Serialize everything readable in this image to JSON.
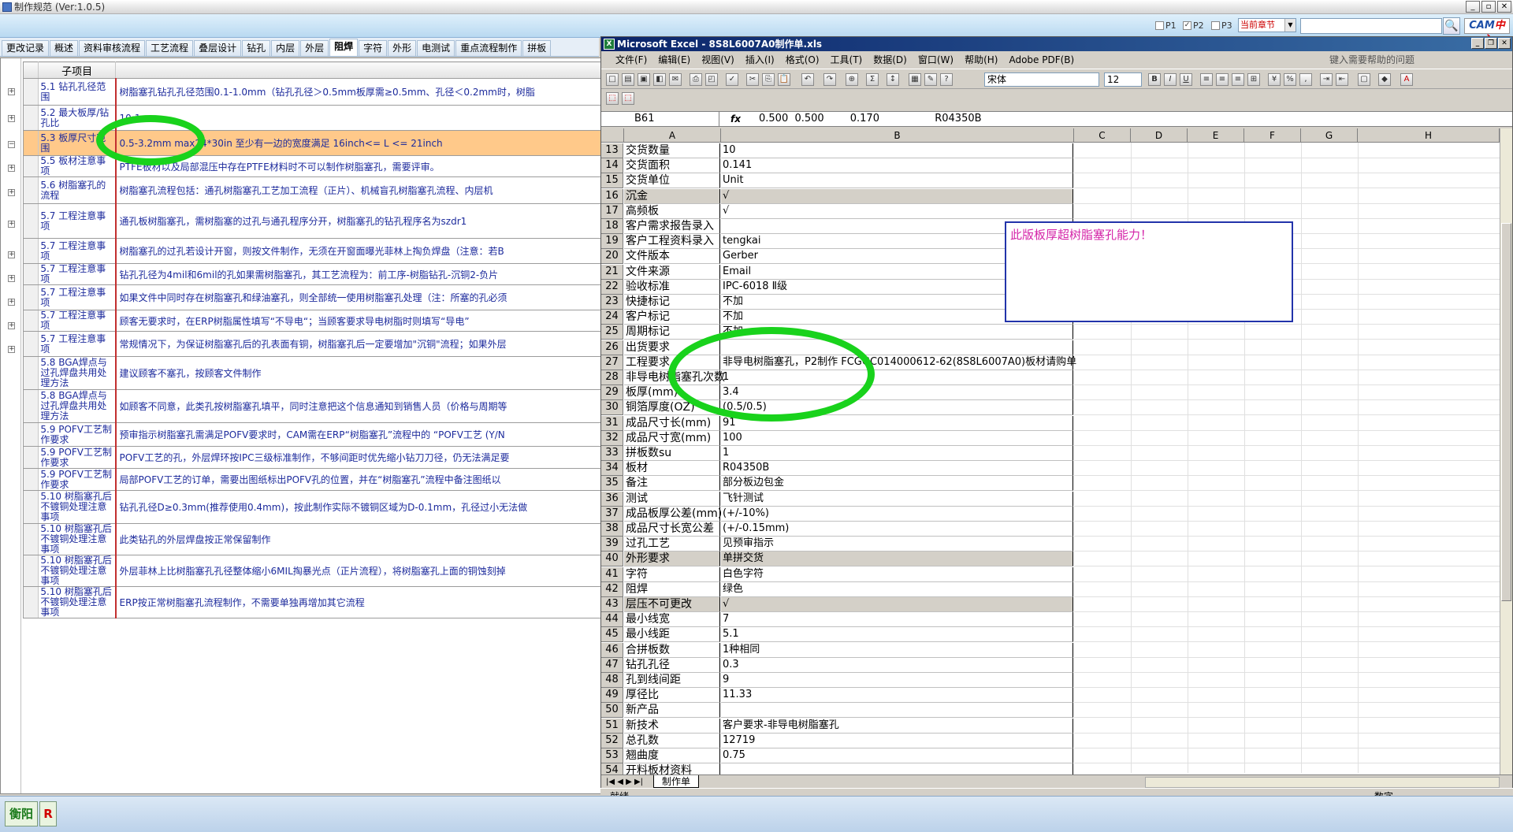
{
  "app": {
    "title": "制作规范 (Ver:1.0.5)",
    "filters": [
      {
        "label": "P1",
        "checked": false
      },
      {
        "label": "P2",
        "checked": true
      },
      {
        "label": "P3",
        "checked": false
      }
    ],
    "scope_select": "当前章节",
    "search_value": "",
    "logo": {
      "main": "CAM",
      "accent": "中心"
    }
  },
  "tabs": [
    "更改记录",
    "概述",
    "资料审核流程",
    "工艺流程",
    "叠层设计",
    "钻孔",
    "内层",
    "外层",
    "阻焊",
    "字符",
    "外形",
    "电测试",
    "重点流程制作",
    "拼板"
  ],
  "active_tab": "阻焊",
  "spec_table": {
    "header": "子项目",
    "rows": [
      {
        "item": "5.1 钻孔孔径范围",
        "text": "树脂塞孔钻孔孔径范围0.1-1.0mm（钻孔孔径＞0.5mm板厚需≥0.5mm、孔径＜0.2mm时，树脂"
      },
      {
        "item": "5.2 最大板厚/钻孔比",
        "text": "10:1"
      },
      {
        "item": "5.3 板厚尺寸范围",
        "text": "0.5-3.2mm    max24*30in 至少有一边的宽度满足 16inch<= L <= 21inch",
        "highlight": true
      },
      {
        "item": "5.5 板材注意事项",
        "text": "PTFE板材以及局部混压中存在PTFE材料时不可以制作树脂塞孔，需要评审。"
      },
      {
        "item": "5.6 树脂塞孔的流程",
        "text": "树脂塞孔流程包括：通孔树脂塞孔工艺加工流程（正片）、机械盲孔树脂塞孔流程、内层机"
      },
      {
        "item": "5.7 工程注意事项",
        "text": "通孔板树脂塞孔，需树脂塞的过孔与通孔程序分开，树脂塞孔的钻孔程序名为szdr1"
      },
      {
        "item": "5.7 工程注意事项",
        "text": "树脂塞孔的过孔若设计开窗，则按文件制作，无须在开窗面曝光菲林上掏负焊盘（注意：若B"
      },
      {
        "item": "5.7 工程注意事项",
        "text": "钻孔孔径为4mil和6mil的孔如果需树脂塞孔，其工艺流程为：前工序-树脂钻孔-沉铜2-负片"
      },
      {
        "item": "5.7 工程注意事项",
        "text": "如果文件中同时存在树脂塞孔和绿油塞孔，则全部统一使用树脂塞孔处理（注：所塞的孔必须"
      },
      {
        "item": "5.7 工程注意事项",
        "text": "顾客无要求时，在ERP树脂属性填写“不导电“；当顾客要求导电树脂时则填写“导电”"
      },
      {
        "item": "5.7 工程注意事项",
        "text": "常规情况下，为保证树脂塞孔后的孔表面有铜，树脂塞孔后一定要增加\"沉铜\"流程；如果外层"
      },
      {
        "item": "5.8 BGA焊点与过孔焊盘共用处理方法",
        "text": "建议顾客不塞孔，按顾客文件制作"
      },
      {
        "item": "5.8 BGA焊点与过孔焊盘共用处理方法",
        "text": "如顾客不同意，此类孔按树脂塞孔填平，同时注意把这个信息通知到销售人员（价格与周期等"
      },
      {
        "item": "5.9 POFV工艺制作要求",
        "text": "预审指示树脂塞孔需满足POFV要求时，CAM需在ERP“树脂塞孔”流程中的 “POFV工艺 (Y/N"
      },
      {
        "item": "5.9 POFV工艺制作要求",
        "text": "POFV工艺的孔，外层焊环按IPC三级标准制作，不够间距时优先缩小钻刀刀径，仍无法满足要"
      },
      {
        "item": "5.9 POFV工艺制作要求",
        "text": "局部POFV工艺的订单，需要出图纸标出POFV孔的位置，并在“树脂塞孔”流程中备注图纸以"
      },
      {
        "item": "5.10 树脂塞孔后不镀铜处理注意事项",
        "text": "钻孔孔径D≥0.3mm(推荐使用0.4mm)，按此制作实际不镀铜区域为D-0.1mm，孔径过小无法做"
      },
      {
        "item": "5.10 树脂塞孔后不镀铜处理注意事项",
        "text": "此类钻孔的外层焊盘按正常保留制作"
      },
      {
        "item": "5.10 树脂塞孔后不镀铜处理注意事项",
        "text": "外层菲林上比树脂塞孔孔径整体缩小6MIL掏暴光点（正片流程），将树脂塞孔上面的铜蚀刻掉"
      },
      {
        "item": "5.10 树脂塞孔后不镀铜处理注意事项",
        "text": "ERP按正常树脂塞孔流程制作，不需要单独再增加其它流程"
      }
    ]
  },
  "excel": {
    "title": "Microsoft Excel - 8S8L6007A0制作单.xls",
    "menus": [
      "文件(F)",
      "编辑(E)",
      "视图(V)",
      "插入(I)",
      "格式(O)",
      "工具(T)",
      "数据(D)",
      "窗口(W)",
      "帮助(H)",
      "Adobe PDF(B)"
    ],
    "help_placeholder": "键入需要帮助的问题",
    "font_name": "宋体",
    "font_size": "12",
    "name_box": "B61",
    "formula": "0.500  0.500        0.170                 R04350B",
    "columns": [
      "A",
      "B",
      "C",
      "D",
      "E",
      "F",
      "G",
      "H"
    ],
    "rows": [
      {
        "n": "13",
        "a": "交货数量",
        "b": "10"
      },
      {
        "n": "14",
        "a": "交货面积",
        "b": "0.141"
      },
      {
        "n": "15",
        "a": "交货单位",
        "b": "Unit"
      },
      {
        "n": "16",
        "a": "沉金",
        "b": "√",
        "gray": true
      },
      {
        "n": "17",
        "a": "高频板",
        "b": "√"
      },
      {
        "n": "18",
        "a": "客户需求报告录入",
        "b": ""
      },
      {
        "n": "19",
        "a": "客户工程资料录入",
        "b": "tengkai"
      },
      {
        "n": "20",
        "a": "文件版本",
        "b": "Gerber"
      },
      {
        "n": "21",
        "a": "文件来源",
        "b": "Email"
      },
      {
        "n": "22",
        "a": "验收标准",
        "b": "IPC-6018 Ⅱ级"
      },
      {
        "n": "23",
        "a": "快捷标记",
        "b": "不加"
      },
      {
        "n": "24",
        "a": "客户标记",
        "b": "不加"
      },
      {
        "n": "25",
        "a": "周期标记",
        "b": "不加"
      },
      {
        "n": "26",
        "a": "出货要求",
        "b": ""
      },
      {
        "n": "27",
        "a": "工程要求",
        "b": "非导电树脂塞孔，P2制作 FCGGC014000612-62(8S8L6007A0)板材请购单"
      },
      {
        "n": "28",
        "a": "非导电树脂塞孔次数",
        "b": "1"
      },
      {
        "n": "29",
        "a": "板厚(mm)",
        "b": "3.4"
      },
      {
        "n": "30",
        "a": "铜箔厚度(OZ)",
        "b": "(0.5/0.5)"
      },
      {
        "n": "31",
        "a": "成品尺寸长(mm)",
        "b": "91"
      },
      {
        "n": "32",
        "a": "成品尺寸宽(mm)",
        "b": "100"
      },
      {
        "n": "33",
        "a": "拼板数su",
        "b": "1"
      },
      {
        "n": "34",
        "a": "板材",
        "b": "R04350B"
      },
      {
        "n": "35",
        "a": "备注",
        "b": "部分板边包金"
      },
      {
        "n": "36",
        "a": "测试",
        "b": "飞针测试"
      },
      {
        "n": "37",
        "a": "成品板厚公差(mm)",
        "b": "(+/-10%)"
      },
      {
        "n": "38",
        "a": "成品尺寸长宽公差",
        "b": "(+/-0.15mm)"
      },
      {
        "n": "39",
        "a": "过孔工艺",
        "b": "见预审指示"
      },
      {
        "n": "40",
        "a": "外形要求",
        "b": "单拼交货",
        "gray": true
      },
      {
        "n": "41",
        "a": "字符",
        "b": "白色字符"
      },
      {
        "n": "42",
        "a": "阻焊",
        "b": "绿色"
      },
      {
        "n": "43",
        "a": "层压不可更改",
        "b": "√",
        "gray": true
      },
      {
        "n": "44",
        "a": "最小线宽",
        "b": "7"
      },
      {
        "n": "45",
        "a": "最小线距",
        "b": "5.1"
      },
      {
        "n": "46",
        "a": "合拼板数",
        "b": "1种相同"
      },
      {
        "n": "47",
        "a": "钻孔孔径",
        "b": "0.3"
      },
      {
        "n": "48",
        "a": "孔到线间距",
        "b": "9"
      },
      {
        "n": "49",
        "a": "厚径比",
        "b": "11.33"
      },
      {
        "n": "50",
        "a": "新产品",
        "b": ""
      },
      {
        "n": "51",
        "a": "新技术",
        "b": "客户要求-非导电树脂塞孔"
      },
      {
        "n": "52",
        "a": "总孔数",
        "b": "12719"
      },
      {
        "n": "53",
        "a": "翘曲度",
        "b": "0.75"
      },
      {
        "n": "54",
        "a": "开料板材资料",
        "b": ""
      }
    ],
    "comment": "此版板厚超树脂塞孔能力！",
    "sheet_tab": "制作单",
    "status_left": "就绪",
    "status_right": "数字"
  },
  "taskbar": [
    {
      "label": "衡阳",
      "color": "#1a7a1a"
    },
    {
      "label": "R",
      "color": "#d00000"
    }
  ]
}
